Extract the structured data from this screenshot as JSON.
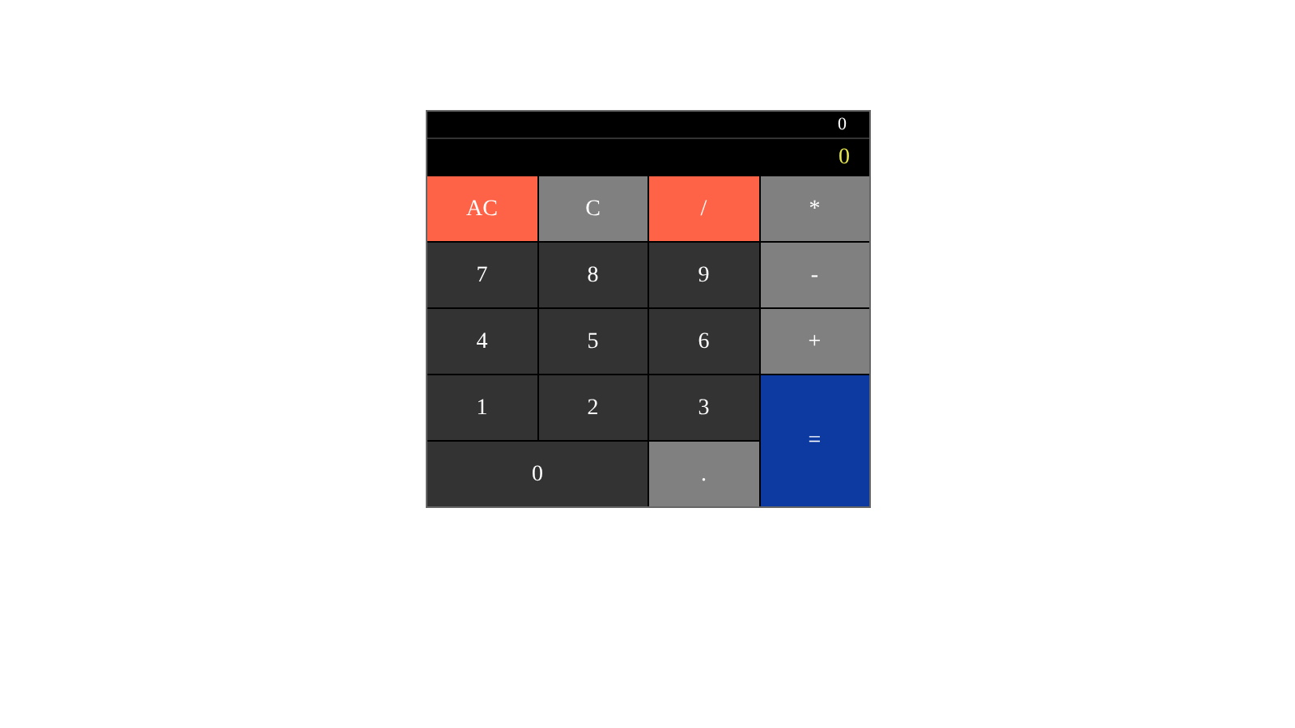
{
  "display": {
    "previous": "0",
    "current": "0"
  },
  "keys": [
    {
      "label": "AC",
      "kind": "clear"
    },
    {
      "label": "C",
      "kind": "operator"
    },
    {
      "label": "/",
      "kind": "clear"
    },
    {
      "label": "*",
      "kind": "operator"
    },
    {
      "label": "7",
      "kind": "digit"
    },
    {
      "label": "8",
      "kind": "digit"
    },
    {
      "label": "9",
      "kind": "digit"
    },
    {
      "label": "-",
      "kind": "operator"
    },
    {
      "label": "4",
      "kind": "digit"
    },
    {
      "label": "5",
      "kind": "digit"
    },
    {
      "label": "6",
      "kind": "digit"
    },
    {
      "label": "+",
      "kind": "operator"
    },
    {
      "label": "1",
      "kind": "digit"
    },
    {
      "label": "2",
      "kind": "digit"
    },
    {
      "label": "3",
      "kind": "digit"
    },
    {
      "label": "=",
      "kind": "equals"
    },
    {
      "label": "0",
      "kind": "wide-digit"
    },
    {
      "label": ".",
      "kind": "operator"
    }
  ]
}
